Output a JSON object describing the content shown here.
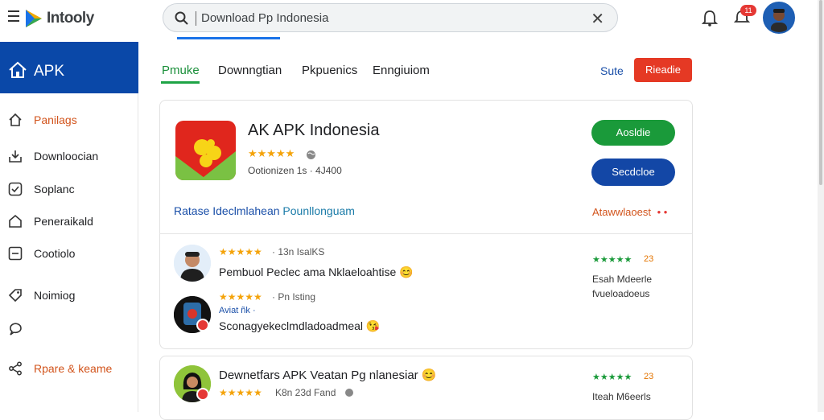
{
  "header": {
    "logo_text": "Intooly",
    "search_value": "Download Pp Indonesia",
    "notification_count": "11"
  },
  "sidebar": {
    "title": "APK",
    "items": [
      {
        "label": "Panilags",
        "color": "#d2541c",
        "icon": "home-outline-icon"
      },
      {
        "label": "Downloocian",
        "color": "#202124",
        "icon": "download-tray-icon"
      },
      {
        "label": "Soplanc",
        "color": "#202124",
        "icon": "checkbox-icon"
      },
      {
        "label": "Peneraikald",
        "color": "#202124",
        "icon": "house-icon"
      },
      {
        "label": "Cootiolo",
        "color": "#202124",
        "icon": "minus-box-icon"
      },
      {
        "label": "Noimiog",
        "color": "#202124",
        "icon": "tag-icon"
      },
      {
        "label": "",
        "color": "#202124",
        "icon": "chat-bubble-icon"
      },
      {
        "label": "Rpare & keame",
        "color": "#d2541c",
        "icon": "share-icon"
      }
    ]
  },
  "tabs": [
    {
      "label": "Pmuke",
      "active": true
    },
    {
      "label": "Downngtian",
      "active": false
    },
    {
      "label": "Pkpuenics",
      "active": false
    },
    {
      "label": "Enngiuiom",
      "active": false
    }
  ],
  "top_actions": {
    "sute_label": "Sute",
    "red_button_label": "Rieadie"
  },
  "app": {
    "title": "AK APK Indonesia",
    "stars": "★★★★★",
    "meta": "Ootionizen 1s · 4J400",
    "primary_button": "Aosldie",
    "secondary_button": "Secdcloe",
    "link_left_a": "Ratase Ideclmlahean",
    "link_left_b": "Pounllonguam",
    "link_right": "Atawwlaoest",
    "link_right_dots": "• •"
  },
  "reviews": [
    {
      "stars": "★★★★★",
      "meta": "· 13n IsalKS",
      "title": "Pembuol Peclec ama Nklaeloahtise 😊",
      "sub": ""
    },
    {
      "stars": "★★★★★",
      "meta": "· Pn Isting",
      "title": "Sconagyekeclmdladoadmeal 😘",
      "sub": "Aviat ñk ·"
    }
  ],
  "review_side": {
    "stars": "★★★★★",
    "count": "23",
    "note_line1": "Esah Mdeerle",
    "note_line2": "fvueloadoeus"
  },
  "card2": {
    "title": "Dewnetfars APK Veatan Pg nlanesiar 😊",
    "stars": "★★★★★",
    "meta": "K8n 23d Fand",
    "side_stars": "★★★★★",
    "side_count": "23",
    "side_note": "Iteah M6eerls"
  }
}
